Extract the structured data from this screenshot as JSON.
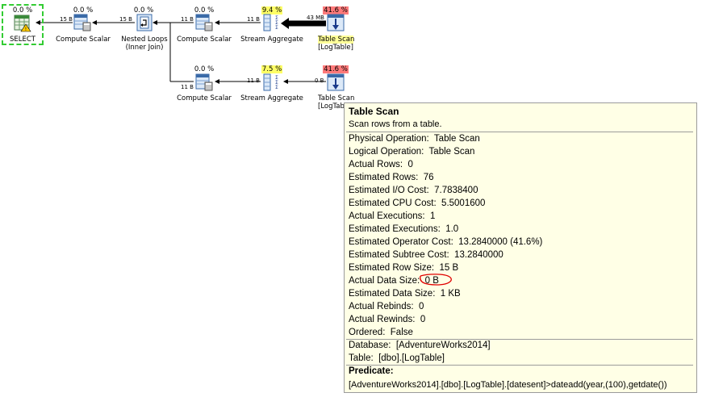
{
  "nodes": {
    "select": {
      "pct": "0.0 %",
      "label": "SELECT"
    },
    "compute1": {
      "pct": "0.0 %",
      "label": "Compute Scalar"
    },
    "nested": {
      "pct": "0.0 %",
      "label": "Nested Loops",
      "sub": "(Inner Join)"
    },
    "compute2": {
      "pct": "0.0 %",
      "label": "Compute Scalar"
    },
    "stream1": {
      "pct": "9.4 %",
      "label": "Stream Aggregate"
    },
    "scan1": {
      "pct": "41.6 %",
      "label": "Table Scan",
      "sub": "[LogTable]"
    },
    "compute3": {
      "pct": "0.0 %",
      "label": "Compute Scalar"
    },
    "stream2": {
      "pct": "7.5 %",
      "label": "Stream Aggregate"
    },
    "scan2": {
      "pct": "41.6 %",
      "label": "Table Scan",
      "sub": "[LogTab"
    }
  },
  "edges": {
    "e1": "15 B",
    "e2": "15 B",
    "e3": "11 B",
    "e4": "11 B",
    "e5": "43 MB",
    "e6": "11 B",
    "e7": "11 B",
    "e8": "0 B"
  },
  "tooltip": {
    "title": "Table Scan",
    "description": "Scan rows from a table.",
    "props": [
      {
        "k": "Physical Operation",
        "v": "Table Scan"
      },
      {
        "k": "Logical Operation",
        "v": "Table Scan"
      },
      {
        "k": "Actual Rows",
        "v": "0"
      },
      {
        "k": "Estimated Rows",
        "v": "76"
      },
      {
        "k": "Estimated I/O Cost",
        "v": "7.7838400"
      },
      {
        "k": "Estimated CPU Cost",
        "v": "5.5001600"
      },
      {
        "k": "Actual Executions",
        "v": "1"
      },
      {
        "k": "Estimated Executions",
        "v": "1.0"
      },
      {
        "k": "Estimated Operator Cost",
        "v": "13.2840000 (41.6%)"
      },
      {
        "k": "Estimated Subtree Cost",
        "v": "13.2840000"
      },
      {
        "k": "Estimated Row Size",
        "v": "15 B"
      },
      {
        "k": "Actual Data Size",
        "v": "0 B"
      },
      {
        "k": "Estimated Data Size",
        "v": "1 KB"
      },
      {
        "k": "Actual Rebinds",
        "v": "0"
      },
      {
        "k": "Actual Rewinds",
        "v": "0"
      },
      {
        "k": "Ordered",
        "v": "False"
      }
    ],
    "database": {
      "k": "Database",
      "v": "[AdventureWorks2014]"
    },
    "table": {
      "k": "Table",
      "v": "[dbo].[LogTable]"
    },
    "predicate_heading": "Predicate:",
    "predicate": "[AdventureWorks2014].[dbo].[LogTable].[datesent]>dateadd(year,(100),getdate())"
  },
  "colors": {
    "cost_high": "#ff7a7a",
    "cost_mid": "#ffff66",
    "select_border": "#33cc33"
  }
}
